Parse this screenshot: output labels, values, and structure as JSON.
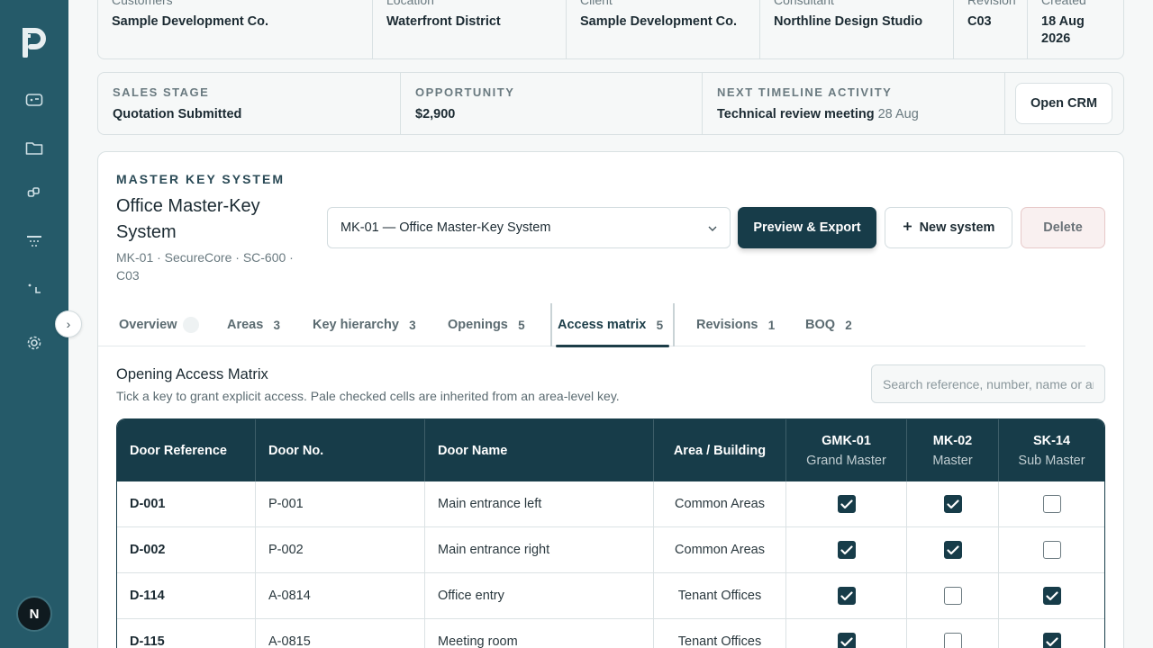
{
  "sidebar": {
    "logo": "brand-logo",
    "nav": [
      "dashboard-icon",
      "folder-icon",
      "keys-icon",
      "door-icon",
      "corner-icon",
      "gear-icon"
    ],
    "avatar_initial": "N",
    "toggle": "›"
  },
  "project_info": [
    {
      "label": "Customers",
      "value": "Sample Development Co."
    },
    {
      "label": "Location",
      "value": "Waterfront District"
    },
    {
      "label": "Client",
      "value": "Sample Development Co."
    },
    {
      "label": "Consultant",
      "value": "Northline Design Studio"
    },
    {
      "label": "Revision",
      "value": "C03"
    },
    {
      "label": "Created",
      "value": "18 Aug 2026"
    }
  ],
  "sales": {
    "stage_label": "SALES STAGE",
    "stage_value": "Quotation Submitted",
    "opp_label": "OPPORTUNITY",
    "opp_value": "$2,900",
    "next_label": "NEXT TIMELINE ACTIVITY",
    "next_value": "Technical review meeting",
    "next_date": "28 Aug",
    "crm_button": "Open CRM"
  },
  "master_key": {
    "eyebrow": "MASTER KEY SYSTEM",
    "title": "Office Master-Key System",
    "subtitle": "MK-01 · SecureCore · SC-600 · C03",
    "selected_system": "MK-01 — Office Master-Key System",
    "export_button": "Preview & Export",
    "new_button": "New system",
    "delete_button": "Delete"
  },
  "tabs": [
    {
      "label": "Overview",
      "count": ""
    },
    {
      "label": "Areas",
      "count": "3"
    },
    {
      "label": "Key hierarchy",
      "count": "3"
    },
    {
      "label": "Openings",
      "count": "5"
    },
    {
      "label": "Access matrix",
      "count": "5"
    },
    {
      "label": "Revisions",
      "count": "1"
    },
    {
      "label": "BOQ",
      "count": "2"
    }
  ],
  "matrix": {
    "title": "Opening Access Matrix",
    "description": "Tick a key to grant explicit access. Pale checked cells are inherited from an area-level key.",
    "search_placeholder": "Search reference, number, name or area",
    "columns": {
      "ref": "Door Reference",
      "no": "Door No.",
      "name": "Door Name",
      "area": "Area / Building"
    },
    "keys": [
      {
        "code": "GMK-01",
        "role": "Grand Master"
      },
      {
        "code": "MK-02",
        "role": "Master"
      },
      {
        "code": "SK-14",
        "role": "Sub Master"
      }
    ],
    "rows": [
      {
        "ref": "D-001",
        "no": "P-001",
        "name": "Main entrance left",
        "area": "Common Areas",
        "access": [
          true,
          true,
          false
        ]
      },
      {
        "ref": "D-002",
        "no": "P-002",
        "name": "Main entrance right",
        "area": "Common Areas",
        "access": [
          true,
          true,
          false
        ]
      },
      {
        "ref": "D-114",
        "no": "A-0814",
        "name": "Office entry",
        "area": "Tenant Offices",
        "access": [
          true,
          false,
          true
        ]
      },
      {
        "ref": "D-115",
        "no": "A-0815",
        "name": "Meeting room",
        "area": "Tenant Offices",
        "access": [
          true,
          false,
          true
        ]
      }
    ]
  },
  "colors": {
    "accent": "#173c49",
    "sidebar": "#255a69"
  }
}
